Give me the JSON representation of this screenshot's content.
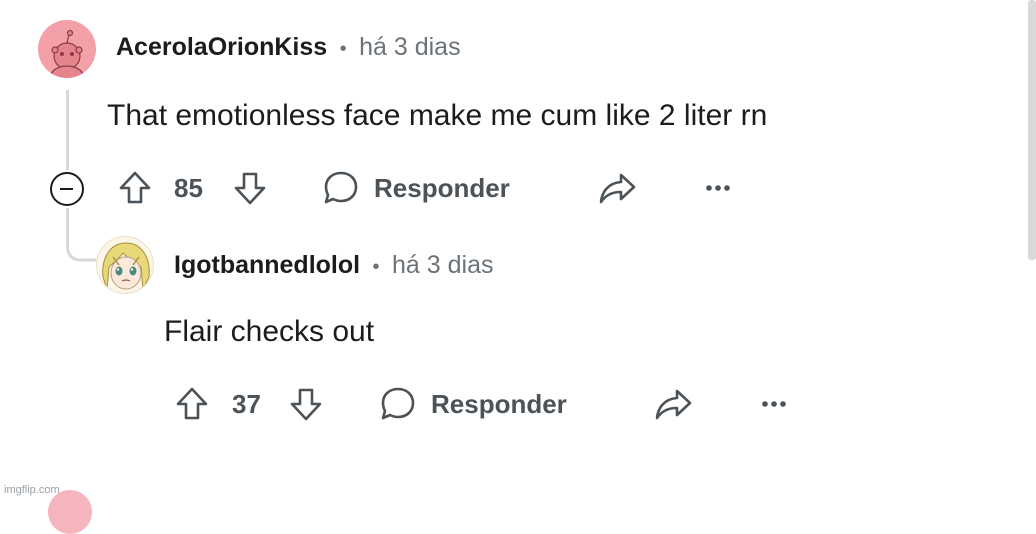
{
  "comments": [
    {
      "username": "AcerolaOrionKiss",
      "separator": "•",
      "time": "há 3 dias",
      "text": "That emotionless face make me cum like 2 liter rn",
      "votes": "85",
      "reply_label": "Responder"
    },
    {
      "username": "Igotbannedlolol",
      "separator": "•",
      "time": "há 3 dias",
      "text": "Flair checks out",
      "votes": "37",
      "reply_label": "Responder"
    }
  ],
  "watermark": "imgflip.com",
  "icons": [
    "collapse-icon",
    "upvote-icon",
    "downvote-icon",
    "comment-bubble-icon",
    "share-icon",
    "more-options-icon"
  ],
  "colors": {
    "avatar_pink": "#f4a0a8",
    "meta_gray": "#6b7378",
    "action_gray": "#4c5358",
    "thread_line": "#d7dadc"
  }
}
